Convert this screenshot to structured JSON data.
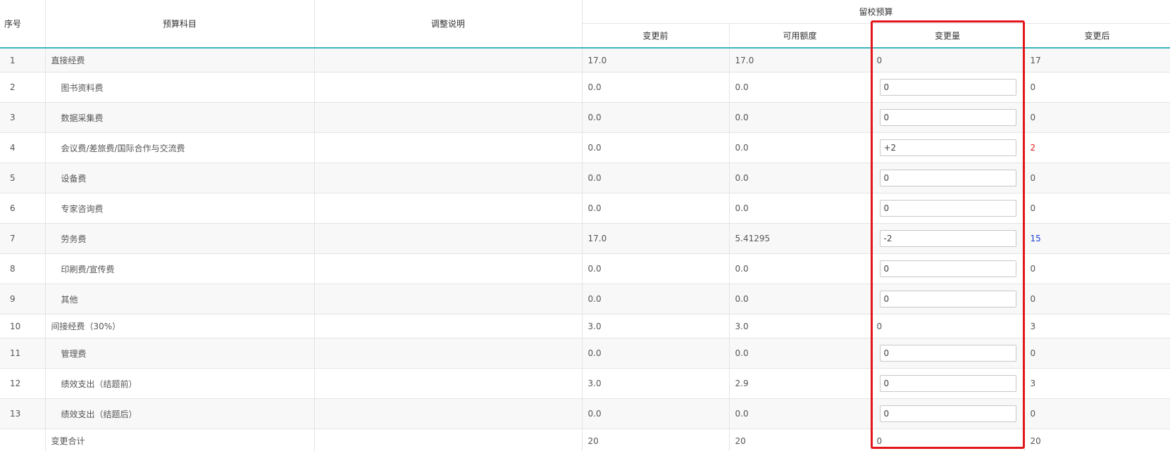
{
  "header": {
    "index": "序号",
    "subject": "预算科目",
    "note": "调整说明",
    "group": "留校预算",
    "before": "变更前",
    "available": "可用额度",
    "change": "变更量",
    "after": "变更后"
  },
  "rows": [
    {
      "index": "1",
      "subject": "直接经费",
      "before": "17.0",
      "available": "17.0",
      "change": "0",
      "after": "17"
    },
    {
      "index": "2",
      "subject": "图书资料费",
      "before": "0.0",
      "available": "0.0",
      "change": "0",
      "after": "0"
    },
    {
      "index": "3",
      "subject": "数据采集费",
      "before": "0.0",
      "available": "0.0",
      "change": "0",
      "after": "0"
    },
    {
      "index": "4",
      "subject": "会议费/差旅费/国际合作与交流费",
      "before": "0.0",
      "available": "0.0",
      "change": "+2",
      "after": "2"
    },
    {
      "index": "5",
      "subject": "设备费",
      "before": "0.0",
      "available": "0.0",
      "change": "0",
      "after": "0"
    },
    {
      "index": "6",
      "subject": "专家咨询费",
      "before": "0.0",
      "available": "0.0",
      "change": "0",
      "after": "0"
    },
    {
      "index": "7",
      "subject": "劳务费",
      "before": "17.0",
      "available": "5.41295",
      "change": "-2",
      "after": "15"
    },
    {
      "index": "8",
      "subject": "印刷费/宣传费",
      "before": "0.0",
      "available": "0.0",
      "change": "0",
      "after": "0"
    },
    {
      "index": "9",
      "subject": "其他",
      "before": "0.0",
      "available": "0.0",
      "change": "0",
      "after": "0"
    },
    {
      "index": "10",
      "subject": "间接经费（30%）",
      "before": "3.0",
      "available": "3.0",
      "change": "0",
      "after": "3"
    },
    {
      "index": "11",
      "subject": "管理费",
      "before": "0.0",
      "available": "0.0",
      "change": "0",
      "after": "0"
    },
    {
      "index": "12",
      "subject": "绩效支出（结题前）",
      "before": "3.0",
      "available": "2.9",
      "change": "0",
      "after": "3"
    },
    {
      "index": "13",
      "subject": "绩效支出（结题后）",
      "before": "0.0",
      "available": "0.0",
      "change": "0",
      "after": "0"
    }
  ],
  "total": {
    "label": "变更合计",
    "before": "20",
    "available": "20",
    "change": "0",
    "after": "20"
  },
  "colors": {
    "header_underline": "#3cb5bf",
    "highlight_border": "#e3151a",
    "positive_value": "#e02020",
    "changed_value": "#1a3fd6"
  }
}
